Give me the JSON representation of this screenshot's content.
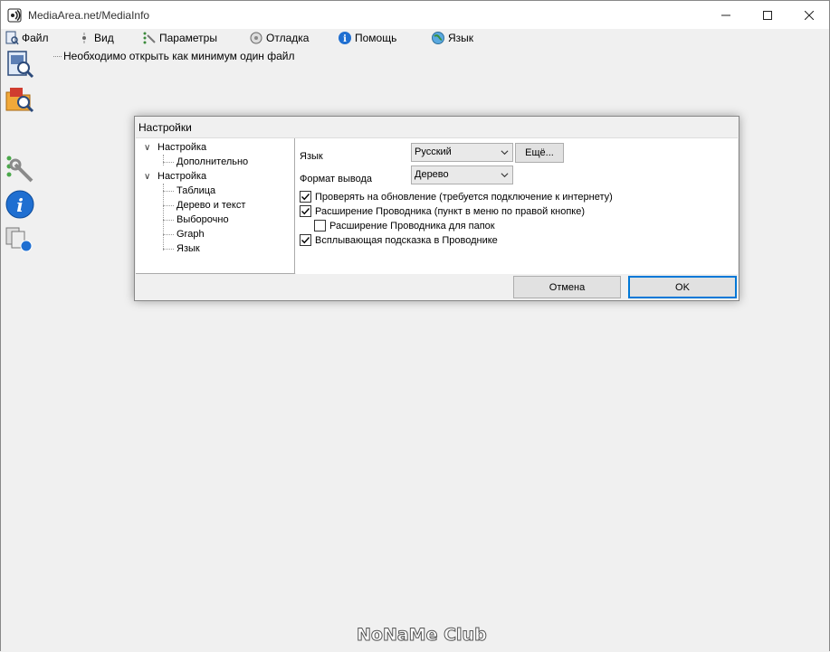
{
  "window": {
    "title": "MediaArea.net/MediaInfo"
  },
  "menu": [
    {
      "label": "Файл",
      "icon": "file-menu-icon"
    },
    {
      "label": "Вид",
      "icon": "view-menu-icon"
    },
    {
      "label": "Параметры",
      "icon": "options-menu-icon"
    },
    {
      "label": "Отладка",
      "icon": "debug-menu-icon"
    },
    {
      "label": "Помощь",
      "icon": "help-menu-icon"
    },
    {
      "label": "Язык",
      "icon": "language-menu-icon"
    }
  ],
  "toolbar": [
    {
      "icon": "open-file-icon"
    },
    {
      "icon": "open-folder-icon"
    },
    {
      "icon": "preferences-icon"
    },
    {
      "icon": "about-icon"
    },
    {
      "icon": "export-icon"
    }
  ],
  "content": {
    "hint": "Необходимо открыть как минимум один файл"
  },
  "dialog": {
    "title": "Настройки",
    "tree": [
      {
        "label": "Настройка",
        "level": 0,
        "expanded": true
      },
      {
        "label": "Дополнительно",
        "level": 1
      },
      {
        "label": "Настройка",
        "level": 0,
        "expanded": true
      },
      {
        "label": "Таблица",
        "level": 1
      },
      {
        "label": "Дерево и текст",
        "level": 1
      },
      {
        "label": "Выборочно",
        "level": 1
      },
      {
        "label": "Graph",
        "level": 1
      },
      {
        "label": "Язык",
        "level": 1
      }
    ],
    "language_label": "Язык",
    "language_value": "Русский",
    "more_button": "Ещё...",
    "output_label": "Формат вывода",
    "output_value": "Дерево",
    "checkboxes": [
      {
        "label": "Проверять на обновление (требуется подключение к интернету)",
        "checked": true
      },
      {
        "label": "Расширение Проводника (пункт в меню по правой кнопке)",
        "checked": true
      },
      {
        "label": "Расширение Проводника для папок",
        "checked": false
      },
      {
        "label": "Всплывающая подсказка в Проводнике",
        "checked": true
      }
    ],
    "cancel_button": "Отмена",
    "ok_button": "OK"
  },
  "watermark": "NoNaMe Club",
  "colors": {
    "accent": "#0078d7",
    "window_bg": "#f0f0f0",
    "panel_bg": "#ffffff"
  }
}
